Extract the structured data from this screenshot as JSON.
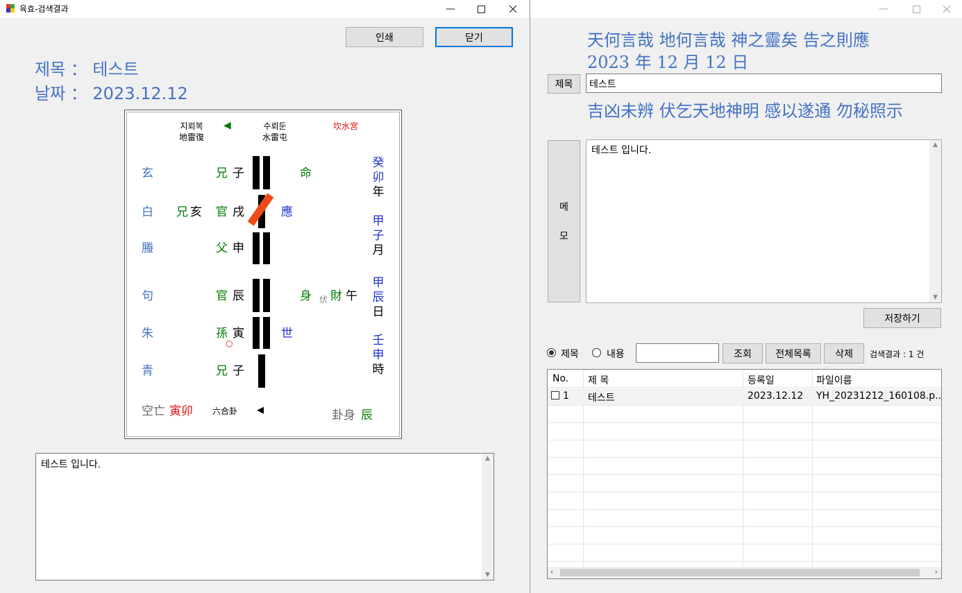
{
  "w1": {
    "title": "육효-검색결과",
    "print": "인쇄",
    "close": "닫기",
    "subject_line": "제목 ： 테스트",
    "date_line": "날짜 ： 2023.12.12",
    "memo": "테스트 입니다."
  },
  "gua": {
    "name_kr": "지뢰복",
    "name_hj": "地雷復",
    "name2_kr": "수뢰둔",
    "name2_hj": "水雷屯",
    "arrow": "◀",
    "palace": "坎水宮",
    "beasts": [
      "玄",
      "白",
      "螣",
      "句",
      "朱",
      "青"
    ],
    "hidden": {
      "rel": "兄",
      "branch": "亥"
    },
    "rels": [
      "兄",
      "官",
      "父",
      "官",
      "孫",
      "兄"
    ],
    "branches": [
      "子",
      "戌",
      "申",
      "辰",
      "寅",
      "子"
    ],
    "ming": "命",
    "ying": "應",
    "shen": "身",
    "fu": "伏",
    "fu_rel": "財",
    "fu_branch": "午",
    "shi": "世",
    "circle": "○",
    "year": [
      "癸",
      "卯",
      "年"
    ],
    "month": [
      "甲",
      "子",
      "月"
    ],
    "day": [
      "甲",
      "辰",
      "日"
    ],
    "hour": [
      "壬",
      "申",
      "時"
    ],
    "kongwang_label": "空亡",
    "kongwang": "寅卯",
    "liuhe": "六合卦",
    "liuhe_arrow": "◀",
    "guashen_label": "卦身",
    "guashen": "辰"
  },
  "w2": {
    "line1": "天何言哉 地何言哉 神之靈矣 告之則應",
    "line2": "2023 年 12 月 12 日",
    "subject_btn": "제목",
    "subject_value": "테스트",
    "line3": "吉凶未辨 伏乞天地神明 感以遂通 勿秘照示",
    "memo_btn": [
      "메",
      "모"
    ],
    "memo": "테스트 입니다.",
    "save": "저장하기",
    "radio_subject": "제목",
    "radio_content": "내용",
    "search_value": "",
    "query": "조회",
    "all_list": "전체목록",
    "delete": "삭제",
    "result": "검색결과 : 1 건",
    "cols": [
      "No.",
      "제 목",
      "등록일",
      "파일이름"
    ],
    "rows": [
      {
        "no": "1",
        "subject": "테스트",
        "date": "2023.12.12",
        "file": "YH_20231212_160108.p..."
      }
    ]
  },
  "colors": {
    "accent": "#4472c4",
    "green": "#007a00",
    "red": "#e01010",
    "blue": "#2233cc",
    "highlight": "#0078d7"
  }
}
